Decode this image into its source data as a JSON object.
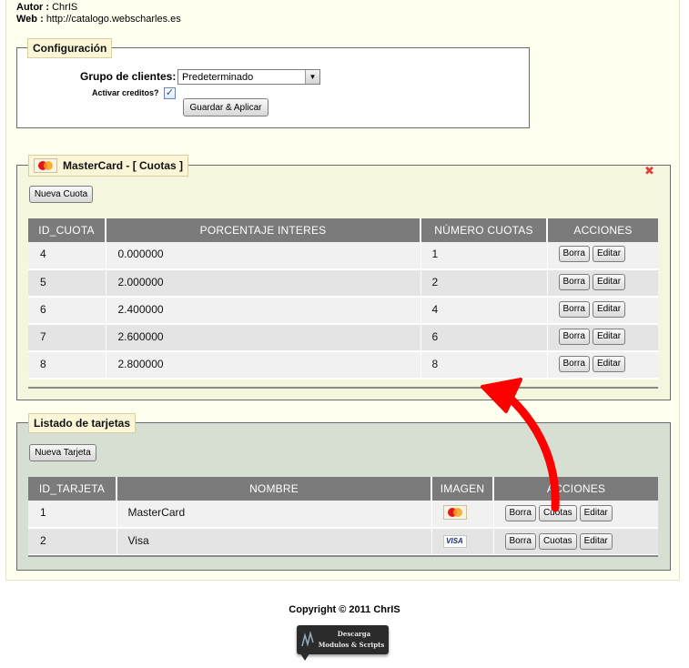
{
  "author": {
    "label": "Autor :",
    "value": "ChrIS"
  },
  "web": {
    "label": "Web :",
    "value": "http://catalogo.webscharles.es"
  },
  "config": {
    "legend": "Configuración",
    "group_label": "Grupo de clientes:",
    "group_value": "Predeterminado",
    "credits_label": "Activar creditos?",
    "credits_checked": true,
    "check_glyph": "✓",
    "save_button": "Guardar & Aplicar"
  },
  "cuotas": {
    "legend": "MasterCard - [ Cuotas ]",
    "logo_icon": "mastercard-logo",
    "close_glyph": "✖",
    "close_color": "#e04040",
    "new_button": "Nueva Cuota",
    "columns": [
      "ID_CUOTA",
      "PORCENTAJE INTERES",
      "NÚMERO CUOTAS",
      "ACCIONES"
    ],
    "rows": [
      {
        "id": "4",
        "pct": "0.000000",
        "num": "1"
      },
      {
        "id": "5",
        "pct": "2.000000",
        "num": "2"
      },
      {
        "id": "6",
        "pct": "2.400000",
        "num": "4"
      },
      {
        "id": "7",
        "pct": "2.600000",
        "num": "6"
      },
      {
        "id": "8",
        "pct": "2.800000",
        "num": "8"
      }
    ],
    "btn_delete": "Borra",
    "btn_edit": "Editar"
  },
  "tarjetas": {
    "legend": "Listado de tarjetas",
    "new_button": "Nueva Tarjeta",
    "columns": [
      "ID_TARJETA",
      "NOMBRE",
      "IMAGEN",
      "ACCIONES"
    ],
    "rows": [
      {
        "id": "1",
        "name": "MasterCard",
        "logo": "mastercard-logo"
      },
      {
        "id": "2",
        "name": "Visa",
        "logo": "visa-logo"
      }
    ],
    "visa_text": "VISA",
    "btn_delete": "Borra",
    "btn_cuotas": "Cuotas",
    "btn_edit": "Editar"
  },
  "annotation": {
    "arrow_color": "#ff0000"
  },
  "footer": {
    "copyright": "Copyright © 2011 ChrIS",
    "banner_line1": "Descarga",
    "banner_line2": "Modulos & Scripts"
  }
}
